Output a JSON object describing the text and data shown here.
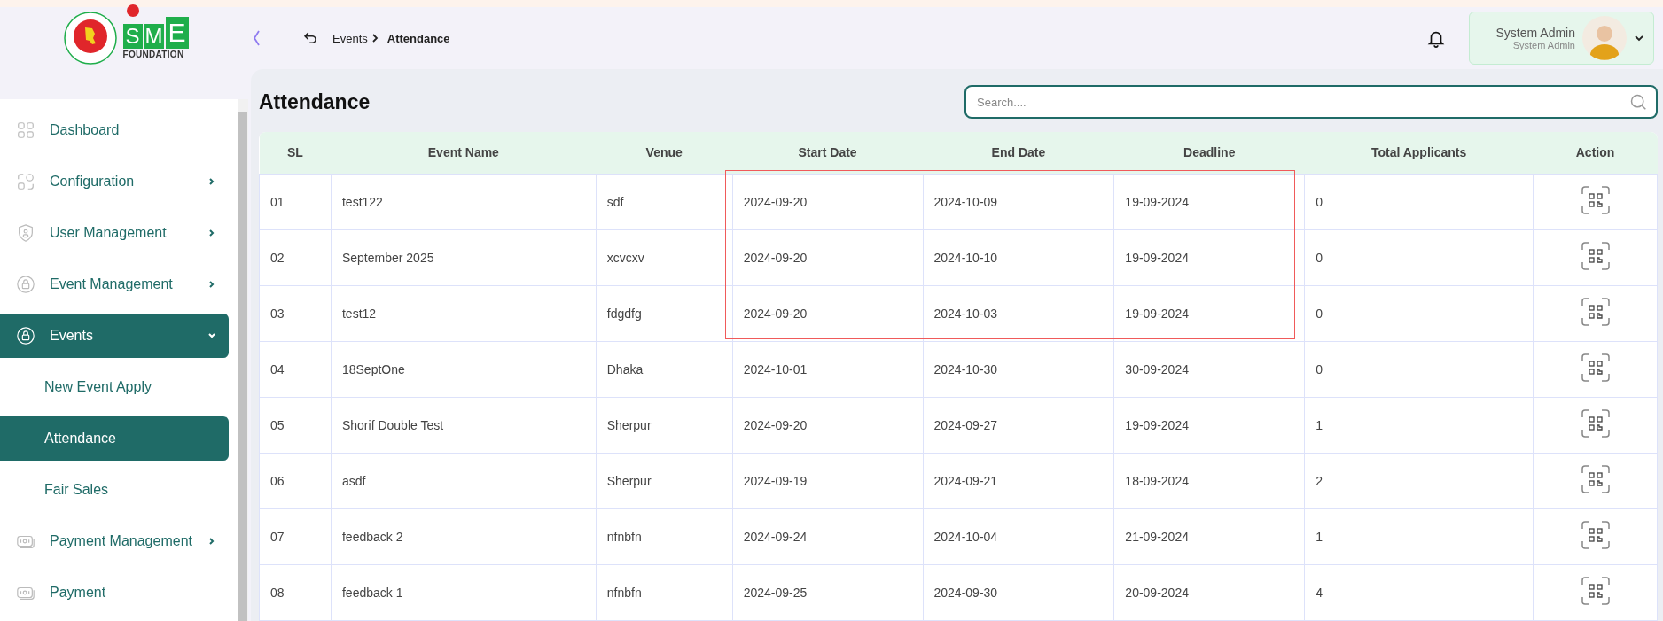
{
  "logo": {
    "letters": [
      "S",
      "M",
      "E"
    ],
    "subtitle": "FOUNDATION"
  },
  "breadcrumb": {
    "parent": "Events",
    "current": "Attendance"
  },
  "user": {
    "name": "System Admin",
    "role": "System Admin"
  },
  "sidebar": {
    "items": [
      {
        "label": "Dashboard",
        "has_arrow": false,
        "selected": false
      },
      {
        "label": "Configuration",
        "has_arrow": true,
        "selected": false
      },
      {
        "label": "User Management",
        "has_arrow": true,
        "selected": false
      },
      {
        "label": "Event Management",
        "has_arrow": true,
        "selected": false
      },
      {
        "label": "Events",
        "has_arrow": true,
        "expanded": true,
        "selected": true,
        "children": [
          {
            "label": "New Event Apply",
            "selected": false
          },
          {
            "label": "Attendance",
            "selected": true
          },
          {
            "label": "Fair Sales",
            "selected": false
          }
        ]
      },
      {
        "label": "Payment Management",
        "has_arrow": true,
        "selected": false
      },
      {
        "label": "Payment",
        "has_arrow": false,
        "selected": false
      }
    ]
  },
  "page_title": "Attendance",
  "search": {
    "placeholder": "Search...."
  },
  "table": {
    "columns": [
      "SL",
      "Event Name",
      "Venue",
      "Start Date",
      "End Date",
      "Deadline",
      "Total Applicants",
      "Action"
    ],
    "rows": [
      [
        "01",
        "test122",
        "sdf",
        "2024-09-20",
        "2024-10-09",
        "19-09-2024",
        "0"
      ],
      [
        "02",
        "September 2025",
        "xcvcxv",
        "2024-09-20",
        "2024-10-10",
        "19-09-2024",
        "0"
      ],
      [
        "03",
        "test12",
        "fdgdfg",
        "2024-09-20",
        "2024-10-03",
        "19-09-2024",
        "0"
      ],
      [
        "04",
        "18SeptOne",
        "Dhaka",
        "2024-10-01",
        "2024-10-30",
        "30-09-2024",
        "0"
      ],
      [
        "05",
        "Shorif Double Test",
        "Sherpur",
        "2024-09-20",
        "2024-09-27",
        "19-09-2024",
        "1"
      ],
      [
        "06",
        "asdf",
        "Sherpur",
        "2024-09-19",
        "2024-09-21",
        "18-09-2024",
        "2"
      ],
      [
        "07",
        "feedback 2",
        "nfnbfn",
        "2024-09-24",
        "2024-10-04",
        "21-09-2024",
        "1"
      ],
      [
        "08",
        "feedback 1",
        "nfnbfn",
        "2024-09-25",
        "2024-09-30",
        "20-09-2024",
        "4"
      ]
    ]
  }
}
